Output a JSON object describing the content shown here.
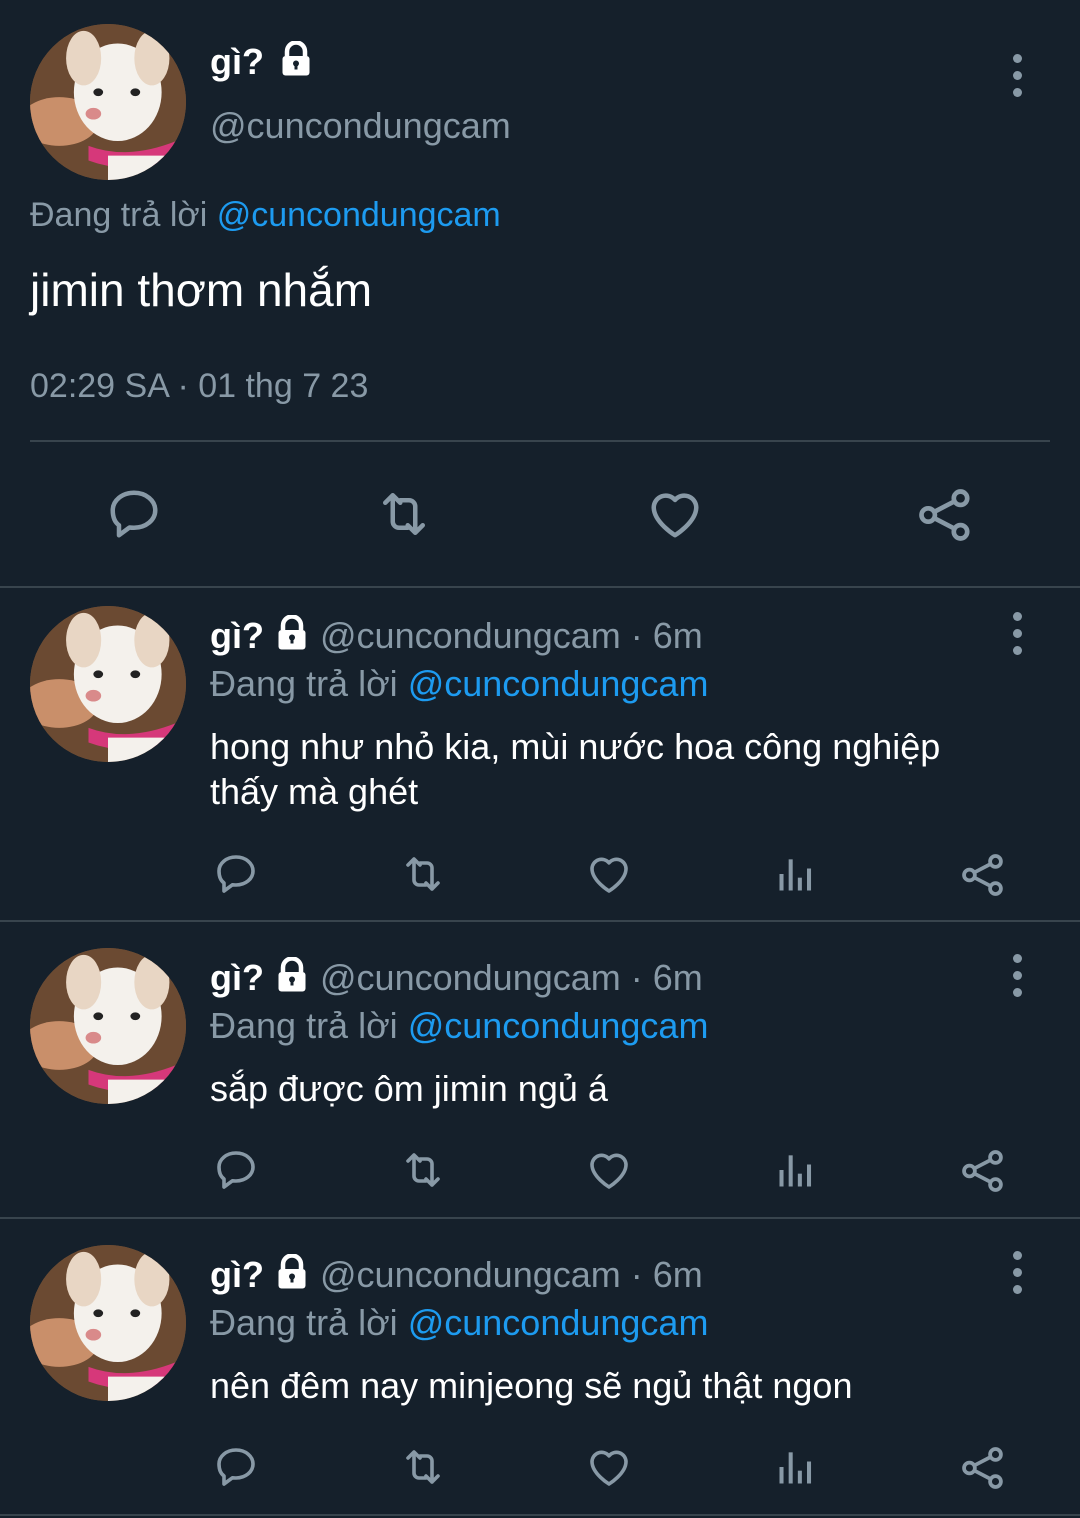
{
  "main_tweet": {
    "display_name": "gì?",
    "handle": "@cuncondungcam",
    "replying_prefix": "Đang trả lời",
    "replying_to": "@cuncondungcam",
    "text": "jimin thơm nhắm",
    "timestamp": "02:29 SA · 01 thg 7 23"
  },
  "replies": [
    {
      "display_name": "gì?",
      "handle": "@cuncondungcam",
      "time": "· 6m",
      "replying_prefix": "Đang trả lời",
      "replying_to": "@cuncondungcam",
      "text_line1": "hong như nhỏ kia, mùi nước hoa công nghiệp",
      "text_line2": "thấy mà ghét"
    },
    {
      "display_name": "gì?",
      "handle": "@cuncondungcam",
      "time": "· 6m",
      "replying_prefix": "Đang trả lời",
      "replying_to": "@cuncondungcam",
      "text_line1": "sắp được ôm jimin ngủ á",
      "text_line2": ""
    },
    {
      "display_name": "gì?",
      "handle": "@cuncondungcam",
      "time": "· 6m",
      "replying_prefix": "Đang trả lời",
      "replying_to": "@cuncondungcam",
      "text_line1": "nên đêm nay minjeong sẽ ngủ thật ngon",
      "text_line2": ""
    }
  ],
  "icons": {
    "reply": "reply-icon",
    "retweet": "retweet-icon",
    "like": "heart-icon",
    "views": "views-icon",
    "share": "share-icon",
    "lock": "lock-icon",
    "more": "more-vertical-icon"
  },
  "colors": {
    "background": "#15202b",
    "link": "#1d9bf0",
    "muted": "#8899a6",
    "divider": "#38444d"
  }
}
